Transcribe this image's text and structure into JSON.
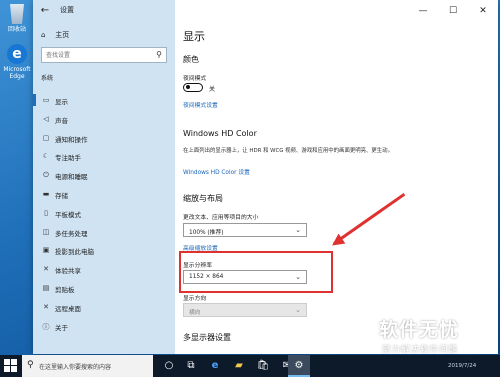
{
  "desktop": {
    "icons": [
      {
        "name": "recycle-bin",
        "label": "回收站"
      },
      {
        "name": "edge",
        "label": "Microsoft Edge"
      }
    ]
  },
  "window": {
    "title": "设置",
    "sidebar": {
      "home": "主页",
      "search_placeholder": "查找设置",
      "section": "系统",
      "items": [
        {
          "icon": "display-icon",
          "label": "显示",
          "active": true
        },
        {
          "icon": "sound-icon",
          "label": "声音"
        },
        {
          "icon": "notifications-icon",
          "label": "通知和操作"
        },
        {
          "icon": "focus-assist-icon",
          "label": "专注助手"
        },
        {
          "icon": "power-icon",
          "label": "电源和睡眠"
        },
        {
          "icon": "storage-icon",
          "label": "存储"
        },
        {
          "icon": "tablet-icon",
          "label": "平板模式"
        },
        {
          "icon": "multitasking-icon",
          "label": "多任务处理"
        },
        {
          "icon": "project-icon",
          "label": "投影到此电脑"
        },
        {
          "icon": "shared-experiences-icon",
          "label": "体验共享"
        },
        {
          "icon": "clipboard-icon",
          "label": "剪贴板"
        },
        {
          "icon": "remote-desktop-icon",
          "label": "远程桌面"
        },
        {
          "icon": "about-icon",
          "label": "关于"
        }
      ]
    },
    "main": {
      "title": "显示",
      "color_section": "颜色",
      "night_light_label": "夜间模式",
      "night_light_state": "关",
      "night_light_link": "夜间模式设置",
      "hdr_title": "Windows HD Color",
      "hdr_desc": "在上面列出的显示器上，让 HDR 和 WCG 视频、游戏和应用中的画面更明亮、更生动。",
      "hdr_link": "Windows HD Color 设置",
      "scale_section": "缩放与布局",
      "scale_label": "更改文本、应用等项目的大小",
      "scale_value": "100% (推荐)",
      "scale_link": "高级缩放设置",
      "resolution_label": "显示分辨率",
      "resolution_value": "1152 × 864",
      "orientation_label": "显示方向",
      "orientation_value": "横向",
      "multi_display_section": "多显示器设置"
    }
  },
  "watermark": {
    "big": "软件无忧",
    "small": "努力解决软件问题"
  },
  "taskbar": {
    "search_placeholder": "在这里输入你要搜索的内容",
    "date": "2019/7/24"
  },
  "colors": {
    "accent": "#1c6fc1",
    "annotation": "#e03131"
  }
}
